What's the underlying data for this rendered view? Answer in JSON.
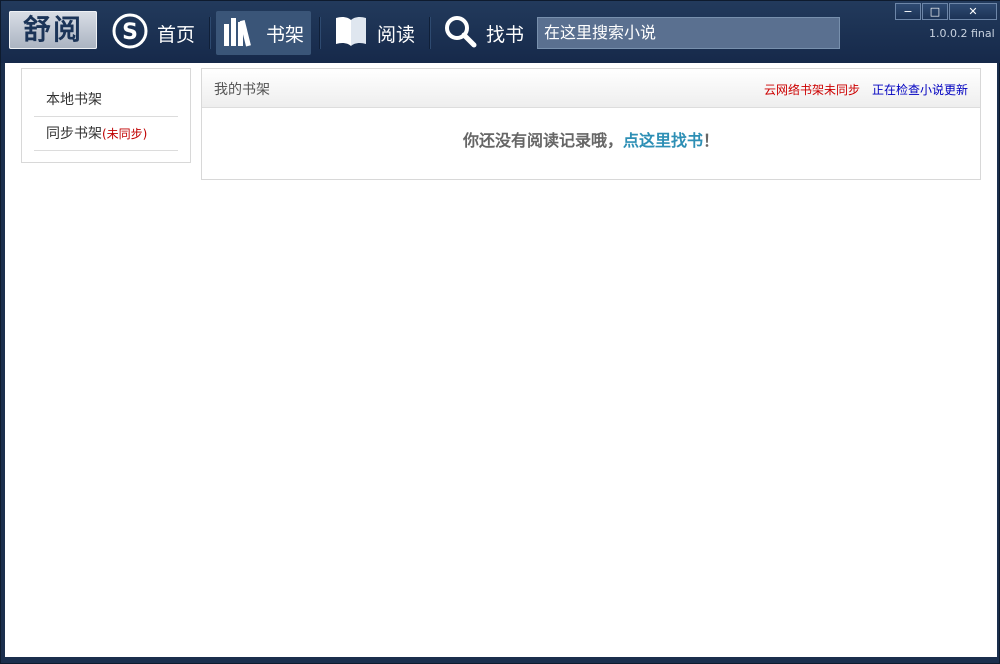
{
  "app": {
    "logo_text": "舒阅",
    "version": "1.0.0.2 final"
  },
  "nav": {
    "home": "首页",
    "shelf": "书架",
    "read": "阅读",
    "find": "找书"
  },
  "search": {
    "placeholder": "在这里搜索小说"
  },
  "window_controls": {
    "minimize": "−",
    "maximize": "□",
    "close": "✕"
  },
  "sidebar": {
    "items": [
      {
        "label": "本地书架"
      },
      {
        "label": "同步书架",
        "tag": "(未同步)"
      }
    ]
  },
  "panel": {
    "title": "我的书架",
    "sync_warning": "云网络书架未同步",
    "update_status": "正在检查小说更新",
    "empty_prefix": "你还没有阅读记录哦，",
    "empty_link": "点这里找书",
    "empty_suffix": "！"
  },
  "colors": {
    "titlebar": "#1b2f4d",
    "active_nav": "#3a5578",
    "link": "#2d8fb5",
    "warning": "#cc0000",
    "status": "#0000c0"
  }
}
